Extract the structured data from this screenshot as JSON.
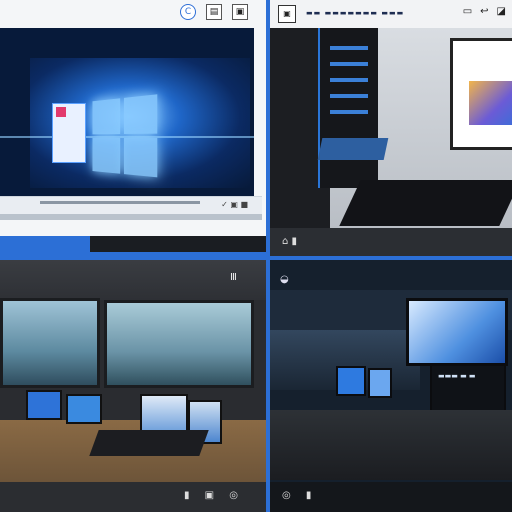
{
  "panels": {
    "top_left": {
      "header_icons": [
        "browser-refresh-icon",
        "document-icon",
        "window-icon"
      ],
      "screen": "windows-desktop-wallpaper",
      "taskbar_icons": "✓ ▣ ■"
    },
    "top_right": {
      "logo_glyph": "▣",
      "header_text": "▬▬ ▬▬▬▬▬▬▬ ▬▬▬",
      "header_buttons": [
        "▭",
        "↩",
        "◪"
      ],
      "floor_icons": "⌂ ▮"
    },
    "bottom_left": {
      "sign_glyph": "Ⅲ",
      "floor_icons": "▮ ▣ ◎"
    },
    "bottom_right": {
      "logo_glyph": "◒",
      "monitor_text": "▬▬▬ ▬ ▬",
      "floor_icons": "◎ ▮"
    }
  }
}
